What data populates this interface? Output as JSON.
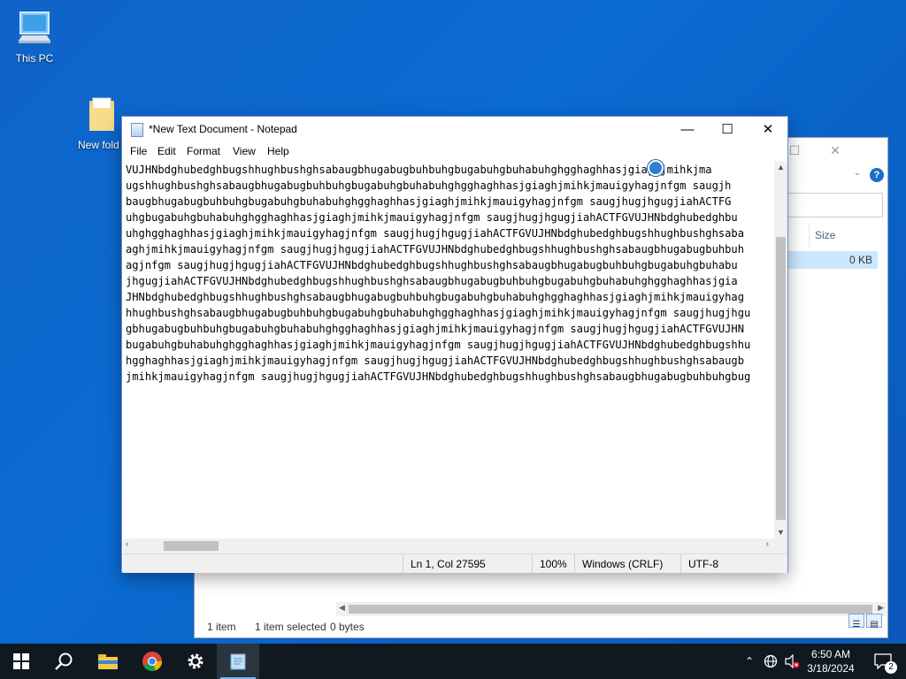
{
  "desktop": {
    "icons": [
      {
        "label": "This PC"
      },
      {
        "label": "New fold"
      }
    ]
  },
  "explorer": {
    "size_header": "Size",
    "row_size": "0 KB",
    "status_items": "1 item",
    "status_selected": "1 item selected",
    "status_bytes": "0 bytes"
  },
  "notepad": {
    "title": "*New Text Document - Notepad",
    "menu": [
      "File",
      "Edit",
      "Format",
      "View",
      "Help"
    ],
    "lines": [
      "VUJHNbdghubedghbugshhughbushghsabaugbhugabugbuhbuhgbugabuhgbuhabuhghgghaghhasjgiaghjmihkjma",
      "ugshhughbushghsabaugbhugabugbuhbuhgbugabuhgbuhabuhghgghaghhasjgiaghjmihkjmauigyhagjnfgm saugjh",
      "baugbhugabugbuhbuhgbugabuhgbuhabuhghgghaghhasjgiaghjmihkjmauigyhagjnfgm saugjhugjhgugjiahACTFG",
      "uhgbugabuhgbuhabuhghgghaghhasjgiaghjmihkjmauigyhagjnfgm saugjhugjhgugjiahACTFGVUJHNbdghubedghbu",
      "uhghgghaghhasjgiaghjmihkjmauigyhagjnfgm saugjhugjhgugjiahACTFGVUJHNbdghubedghbugshhughbushghsaba",
      "aghjmihkjmauigyhagjnfgm saugjhugjhgugjiahACTFGVUJHNbdghubedghbugshhughbushghsabaugbhugabugbuhbuh",
      "agjnfgm saugjhugjhgugjiahACTFGVUJHNbdghubedghbugshhughbushghsabaugbhugabugbuhbuhgbugabuhgbuhabu",
      "jhgugjiahACTFGVUJHNbdghubedghbugshhughbushghsabaugbhugabugbuhbuhgbugabuhgbuhabuhghgghaghhasjgia",
      "JHNbdghubedghbugshhughbushghsabaugbhugabugbuhbuhgbugabuhgbuhabuhghgghaghhasjgiaghjmihkjmauigyhag",
      "hhughbushghsabaugbhugabugbuhbuhgbugabuhgbuhabuhghgghaghhasjgiaghjmihkjmauigyhagjnfgm saugjhugjhgu",
      "gbhugabugbuhbuhgbugabuhgbuhabuhghgghaghhasjgiaghjmihkjmauigyhagjnfgm saugjhugjhgugjiahACTFGVUJHN",
      "bugabuhgbuhabuhghgghaghhasjgiaghjmihkjmauigyhagjnfgm saugjhugjhgugjiahACTFGVUJHNbdghubedghbugshhu",
      "hgghaghhasjgiaghjmihkjmauigyhagjnfgm saugjhugjhgugjiahACTFGVUJHNbdghubedghbugshhughbushghsabaugb",
      "jmihkjmauigyhagjnfgm saugjhugjhgugjiahACTFGVUJHNbdghubedghbugshhughbushghsabaugbhugabugbuhbuhgbug"
    ],
    "status": {
      "position": "Ln 1, Col 27595",
      "zoom": "100%",
      "line_ending": "Windows (CRLF)",
      "encoding": "UTF-8"
    }
  },
  "taskbar": {
    "clock_time": "6:50 AM",
    "clock_date": "3/18/2024",
    "notification_count": "2"
  }
}
